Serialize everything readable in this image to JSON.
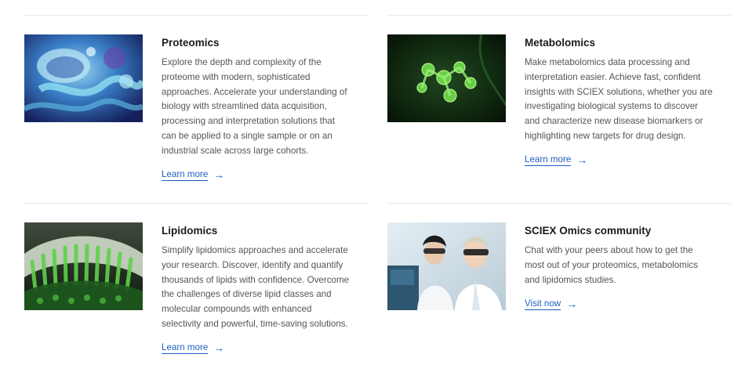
{
  "cards": [
    {
      "title": "Proteomics",
      "description_lines": [
        "Explore the depth and complexity of the",
        "proteome with modern, sophisticated",
        "approaches. Accelerate your understanding of",
        "biology with streamlined data acquisition,",
        "processing and interpretation solutions that",
        "can be applied to a single sample or on an",
        "industrial scale across large cohorts."
      ],
      "link_label": "Learn more",
      "image_icon": "proteomics-image"
    },
    {
      "title": "Metabolomics",
      "description_lines": [
        "Make metabolomics data processing and",
        "interpretation easier. Achieve fast, confident",
        "insights with SCIEX solutions, whether you are",
        "investigating biological systems to discover",
        "and characterize new disease biomarkers or",
        "highlighting new targets for drug design."
      ],
      "link_label": "Learn more",
      "image_icon": "metabolomics-image"
    },
    {
      "title": "Lipidomics",
      "description_lines": [
        "Simplify lipidomics approaches and accelerate",
        "your research. Discover, identify and quantify",
        "thousands of lipids with confidence. Overcome",
        "the challenges of diverse lipid classes and",
        "molecular compounds with enhanced",
        "selectivity and powerful, time-saving solutions."
      ],
      "link_label": "Learn more",
      "image_icon": "lipidomics-image"
    },
    {
      "title": "SCIEX Omics community",
      "description_lines": [
        "Chat with your peers about how to get the",
        "most out of your proteomics, metabolomics",
        "and lipidomics studies."
      ],
      "link_label": "Visit now",
      "image_icon": "scientists-photo"
    }
  ],
  "arrow_glyph": "→",
  "colors": {
    "link": "#1f5fc4",
    "title": "#1b1b1b",
    "body": "#555555",
    "divider": "#e6e6e6"
  }
}
